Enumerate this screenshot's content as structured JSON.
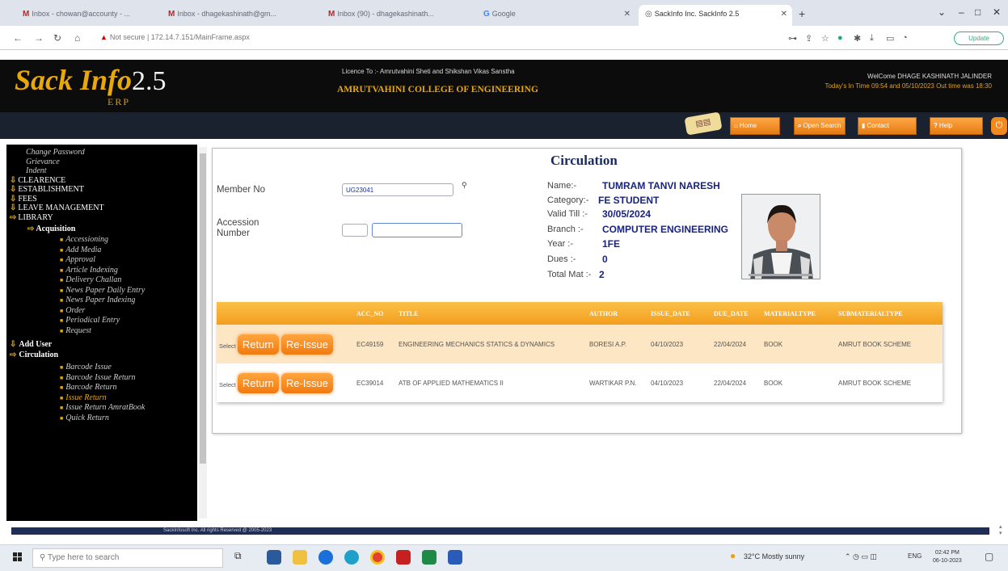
{
  "browser": {
    "tabs": [
      {
        "label": "Inbox - chowan@accounty - ..."
      },
      {
        "label": "Inbox - dhagekashinath@gm..."
      },
      {
        "label": "Inbox (90) - dhagekashinath..."
      },
      {
        "label": "Google"
      },
      {
        "label": "SackInfo Inc. SackInfo 2.5"
      }
    ],
    "url": "Not secure | 172.14.7.151/MainFrame.aspx",
    "update_label": "Update"
  },
  "app": {
    "logo_main": "Sack Info",
    "logo_version": "2.5",
    "logo_sub": "ERP",
    "licence": "Licence To :- Amrutvahini Sheti and Shikshan Vikas Sanstha",
    "college": "AMRUTVAHINI COLLEGE OF ENGINEERING",
    "welcome": "WelCome DHAGE KASHINATH JALINDER",
    "intime": "Today's In Time 09:54 and 05/10/2023 Out time was 18:30",
    "nav": {
      "home": "Home",
      "open_search": "Open Search",
      "contact": "Contact",
      "help": "Help"
    }
  },
  "sidebar": {
    "links": [
      "Change Password",
      "Grievance",
      "Indent"
    ],
    "menus": [
      "CLEARENCE",
      "ESTABLISHMENT",
      "FEES",
      "LEAVE MANAGEMENT",
      "LIBRARY"
    ],
    "acquisition": {
      "label": "Acquisition",
      "items": [
        "Accessioning",
        "Add Media",
        "Approval",
        "Article Indexing",
        "Delivery Challan",
        "News Paper Daily Entry",
        "News Paper Indexing",
        "Order",
        "Periodical Entry",
        "Request"
      ]
    },
    "add_user": "Add User",
    "circulation": {
      "label": "Circulation",
      "items": [
        "Barcode Issue",
        "Barcode Issue Return",
        "Barcode Return",
        "Issue Return",
        "Issue Return AmratBook",
        "Quick Return"
      ]
    }
  },
  "circulation": {
    "title": "Circulation",
    "member_label": "Member No",
    "member_value": "UG23041",
    "accession_label": "Accession Number",
    "search_icon_text": "🔍",
    "details": [
      {
        "label": "Name:-",
        "value": "TUMRAM TANVI NARESH"
      },
      {
        "label": "Category:-",
        "value": "FE STUDENT"
      },
      {
        "label": "Valid Till :-",
        "value": "30/05/2024"
      },
      {
        "label": "Branch :-",
        "value": "COMPUTER ENGINEERING"
      },
      {
        "label": "Year :-",
        "value": "1FE"
      },
      {
        "label": "Dues :-",
        "value": "0"
      },
      {
        "label": "Total Mat :-",
        "value": "2"
      }
    ],
    "table": {
      "headers": [
        "ACC_NO",
        "TITLE",
        "AUTHOR",
        "ISSUE_DATE",
        "DUE_DATE",
        "MATERIALTYPE",
        "SUBMATERIALTYPE"
      ],
      "select_label": "Select",
      "return_label": "Return",
      "reissue_label": "Re-Issue",
      "rows": [
        {
          "acc": "EC49159",
          "title": "ENGINEERING MECHANICS STATICS & DYNAMICS",
          "author": "BORESI A.P.",
          "issue": "04/10/2023",
          "due": "22/04/2024",
          "mtype": "BOOK",
          "stype": "AMRUT BOOK SCHEME"
        },
        {
          "acc": "EC39014",
          "title": "ATB OF APPLIED MATHEMATICS II",
          "author": "WARTIKAR P.N.",
          "issue": "04/10/2023",
          "due": "22/04/2024",
          "mtype": "BOOK",
          "stype": "AMRUT BOOK SCHEME"
        }
      ]
    }
  },
  "footer": "SackInfosoft Inc. All rights Reserved @ 2005-2023",
  "taskbar": {
    "search_placeholder": "Type here to search",
    "weather": "32°C Mostly sunny",
    "lang": "ENG",
    "time": "02:42 PM",
    "date": "06-10-2023"
  }
}
